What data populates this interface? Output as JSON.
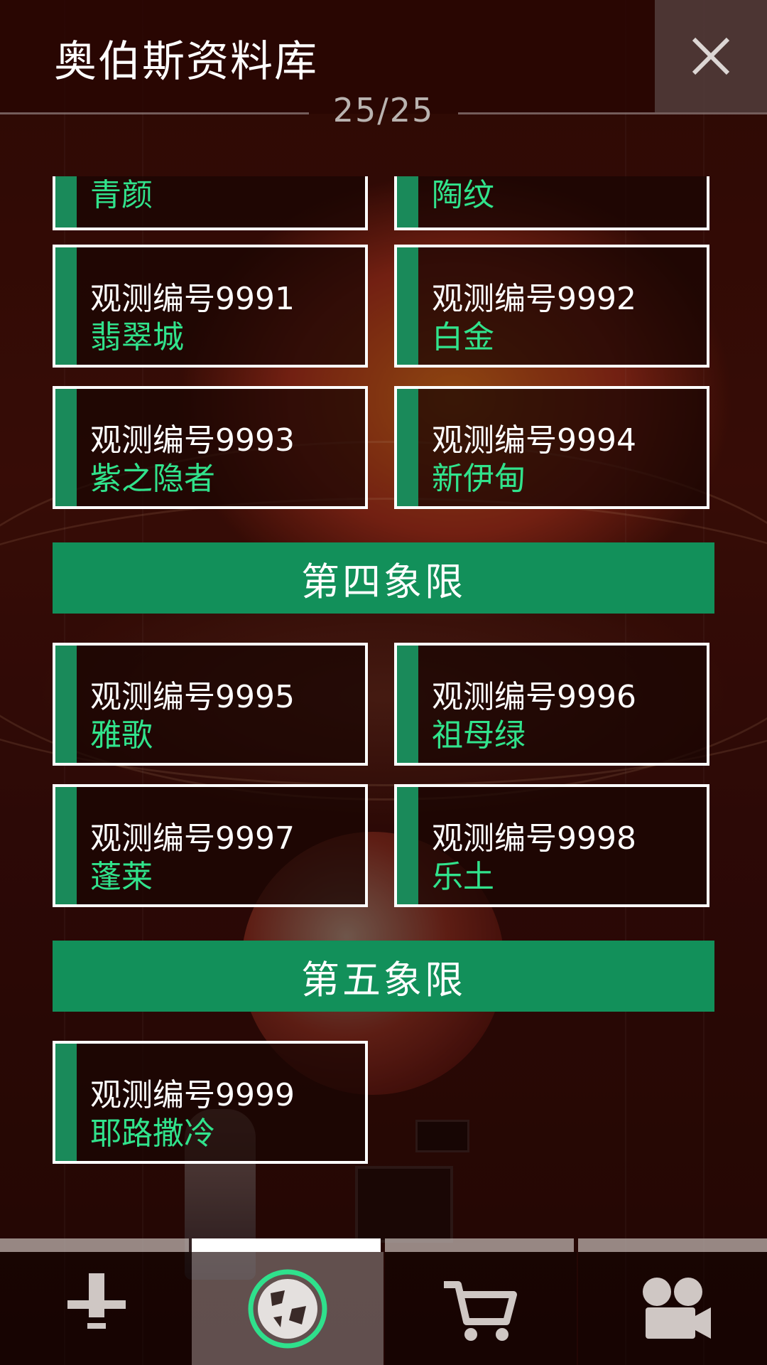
{
  "header": {
    "title": "奥伯斯资料库",
    "counter": "25/25"
  },
  "partial_row": [
    {
      "name": "青颜"
    },
    {
      "name": "陶纹"
    }
  ],
  "groups": [
    {
      "rows": [
        [
          {
            "id": "观测编号9991",
            "name": "翡翠城"
          },
          {
            "id": "观测编号9992",
            "name": "白金"
          }
        ],
        [
          {
            "id": "观测编号9993",
            "name": "紫之隐者"
          },
          {
            "id": "观测编号9994",
            "name": "新伊甸"
          }
        ]
      ]
    }
  ],
  "sections": [
    {
      "title": "第四象限",
      "cards": [
        {
          "id": "观测编号9995",
          "name": "雅歌"
        },
        {
          "id": "观测编号9996",
          "name": "祖母绿"
        },
        {
          "id": "观测编号9997",
          "name": "蓬莱"
        },
        {
          "id": "观测编号9998",
          "name": "乐土"
        }
      ]
    },
    {
      "title": "第五象限",
      "cards": [
        {
          "id": "观测编号9999",
          "name": "耶路撒冷"
        }
      ]
    }
  ],
  "nav": {
    "active_index": 1,
    "items": [
      {
        "icon": "tool-icon"
      },
      {
        "icon": "planet-icon"
      },
      {
        "icon": "cart-icon"
      },
      {
        "icon": "camera-icon"
      }
    ]
  },
  "colors": {
    "accent_green": "#12905a",
    "name_green": "#31e38c",
    "bar_green": "#1a8a5a"
  }
}
